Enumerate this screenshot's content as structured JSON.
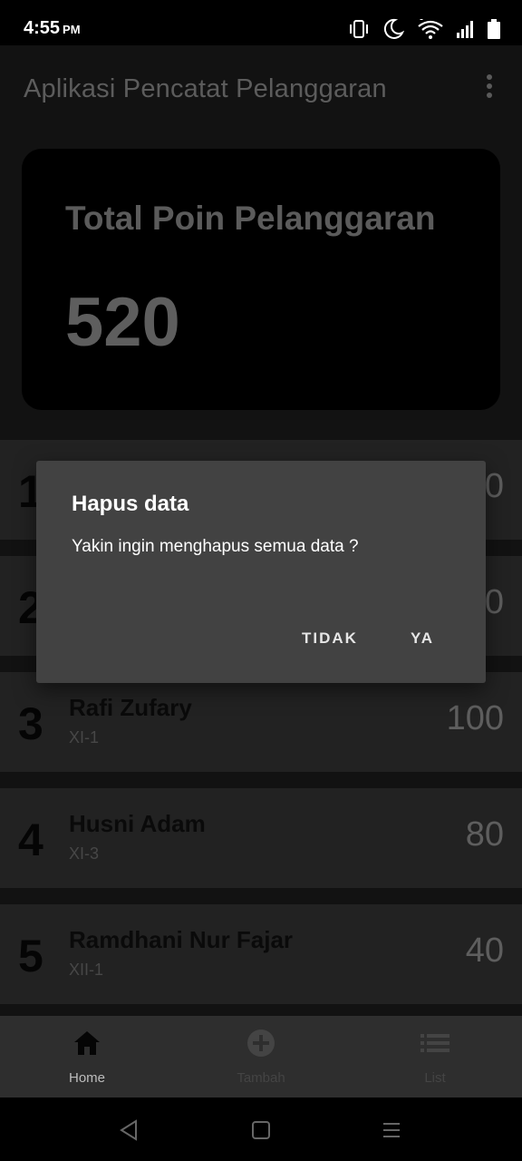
{
  "status_bar": {
    "time": "4:55",
    "ampm": "PM",
    "icons": [
      "vibrate-icon",
      "moon-icon",
      "wifi-icon",
      "signal-icon",
      "battery-icon"
    ]
  },
  "app": {
    "title": "Aplikasi Pencatat Pelanggaran",
    "menu_icon": "more-vert-icon"
  },
  "total": {
    "label": "Total Poin Pelanggaran",
    "value": "520"
  },
  "list": [
    {
      "rank": "1",
      "name": "",
      "class": "",
      "points": "0"
    },
    {
      "rank": "2",
      "name": "",
      "class": "",
      "points": "0"
    },
    {
      "rank": "3",
      "name": "Rafi Zufary",
      "class": "XI-1",
      "points": "100"
    },
    {
      "rank": "4",
      "name": "Husni Adam",
      "class": "XI-3",
      "points": "80"
    },
    {
      "rank": "5",
      "name": "Ramdhani Nur Fajar",
      "class": "XII-1",
      "points": "40"
    }
  ],
  "bottom_nav": {
    "items": [
      {
        "label": "Home",
        "icon": "home-icon",
        "selected": true
      },
      {
        "label": "Tambah",
        "icon": "add-circle-icon",
        "selected": false
      },
      {
        "label": "List",
        "icon": "list-icon",
        "selected": false
      }
    ]
  },
  "system_nav": {
    "icons": [
      "back-icon",
      "home-square-icon",
      "menu-lines-icon"
    ]
  },
  "dialog": {
    "title": "Hapus data",
    "message": "Yakin ingin menghapus semua data ?",
    "negative_label": "TIDAK",
    "positive_label": "YA"
  },
  "colors": {
    "dialog_bg": "#424242",
    "app_bg": "#121212",
    "card_bg": "#000000",
    "nav_bg": "#2e2e2e"
  }
}
